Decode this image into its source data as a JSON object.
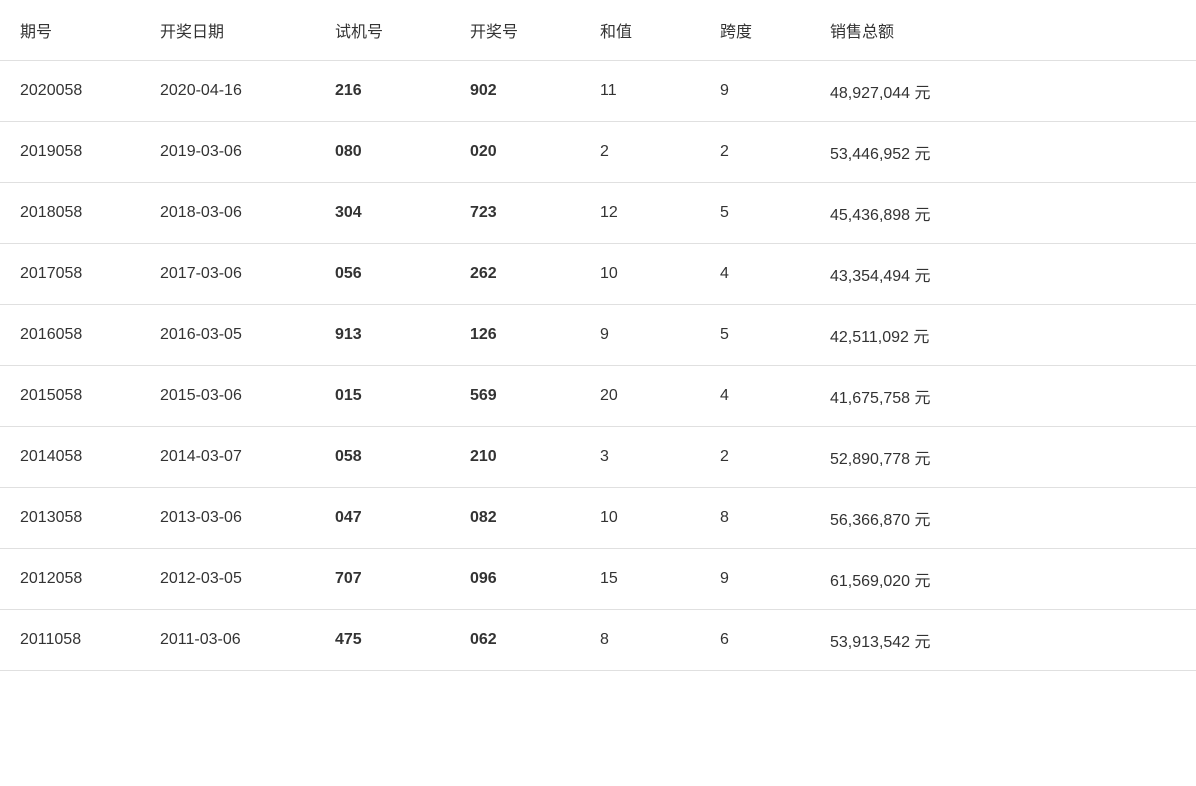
{
  "table": {
    "headers": [
      "期号",
      "开奖日期",
      "试机号",
      "开奖号",
      "和值",
      "跨度",
      "销售总额"
    ],
    "rows": [
      {
        "period": "2020058",
        "date": "2020-04-16",
        "trial": "216",
        "winning": "902",
        "sum": "11",
        "span": "9",
        "sales": "48,927,044 元"
      },
      {
        "period": "2019058",
        "date": "2019-03-06",
        "trial": "080",
        "winning": "020",
        "sum": "2",
        "span": "2",
        "sales": "53,446,952 元"
      },
      {
        "period": "2018058",
        "date": "2018-03-06",
        "trial": "304",
        "winning": "723",
        "sum": "12",
        "span": "5",
        "sales": "45,436,898 元"
      },
      {
        "period": "2017058",
        "date": "2017-03-06",
        "trial": "056",
        "winning": "262",
        "sum": "10",
        "span": "4",
        "sales": "43,354,494 元"
      },
      {
        "period": "2016058",
        "date": "2016-03-05",
        "trial": "913",
        "winning": "126",
        "sum": "9",
        "span": "5",
        "sales": "42,511,092 元"
      },
      {
        "period": "2015058",
        "date": "2015-03-06",
        "trial": "015",
        "winning": "569",
        "sum": "20",
        "span": "4",
        "sales": "41,675,758 元"
      },
      {
        "period": "2014058",
        "date": "2014-03-07",
        "trial": "058",
        "winning": "210",
        "sum": "3",
        "span": "2",
        "sales": "52,890,778 元"
      },
      {
        "period": "2013058",
        "date": "2013-03-06",
        "trial": "047",
        "winning": "082",
        "sum": "10",
        "span": "8",
        "sales": "56,366,870 元"
      },
      {
        "period": "2012058",
        "date": "2012-03-05",
        "trial": "707",
        "winning": "096",
        "sum": "15",
        "span": "9",
        "sales": "61,569,020 元"
      },
      {
        "period": "2011058",
        "date": "2011-03-06",
        "trial": "475",
        "winning": "062",
        "sum": "8",
        "span": "6",
        "sales": "53,913,542 元"
      }
    ]
  }
}
